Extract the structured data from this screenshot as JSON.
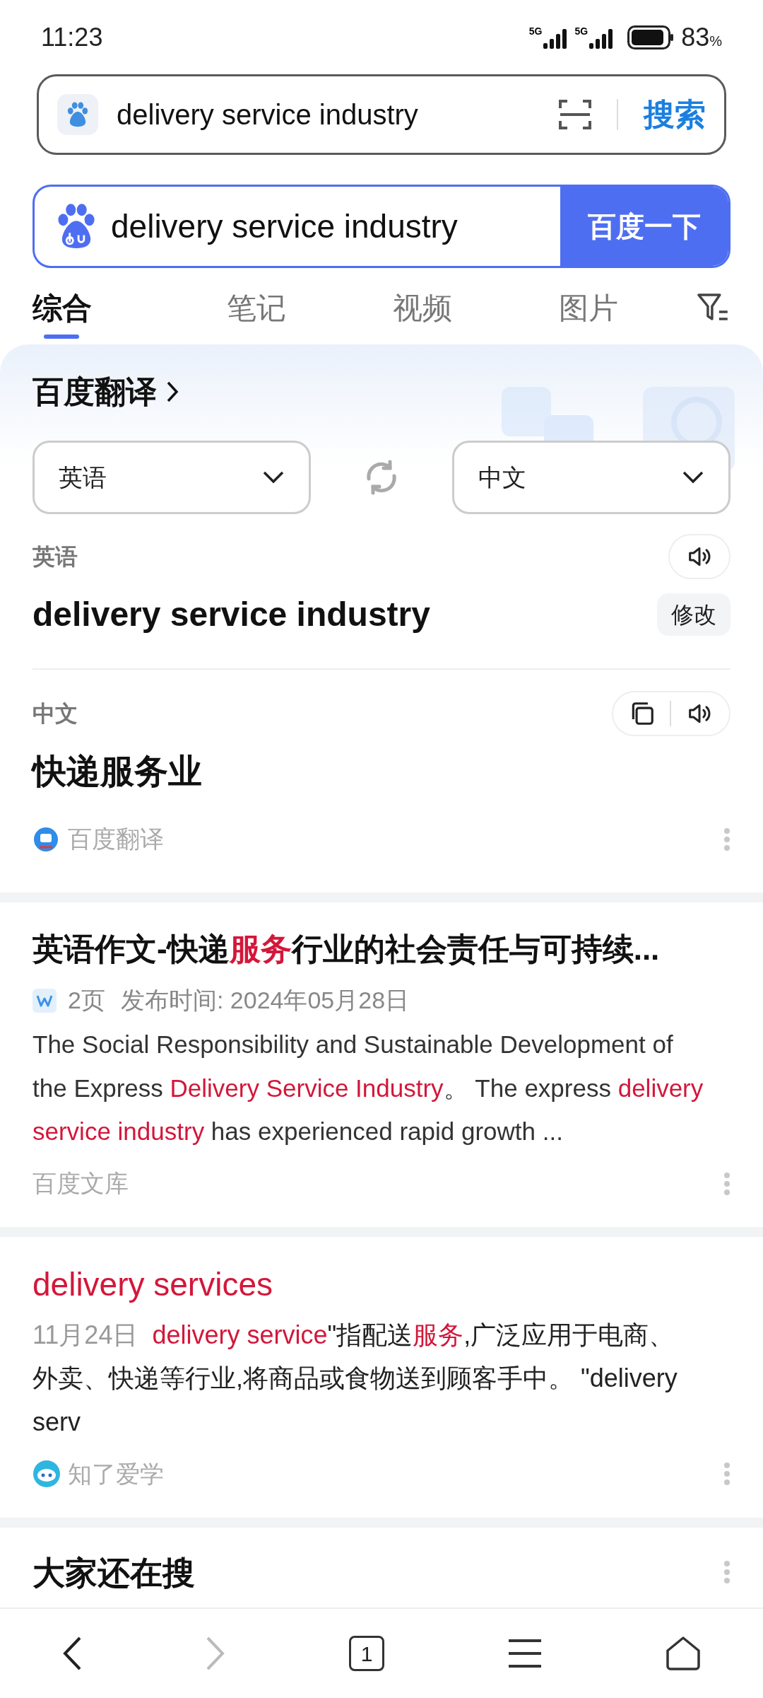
{
  "status_bar": {
    "time": "11:23",
    "network": [
      "5G",
      "5G"
    ],
    "battery": "83",
    "battery_unit": "%"
  },
  "browser_bar": {
    "query": "delivery service industry",
    "search_button": "搜索"
  },
  "search": {
    "query": "delivery service industry",
    "button": "百度一下"
  },
  "tabs": [
    {
      "label": "综合",
      "selected": true
    },
    {
      "label": "笔记",
      "selected": false
    },
    {
      "label": "视频",
      "selected": false
    },
    {
      "label": "图片",
      "selected": false
    }
  ],
  "translate_card": {
    "title": "百度翻译",
    "source_language": "英语",
    "target_language": "中文",
    "source_label": "英语",
    "source_text": "delivery service industry",
    "edit_button": "修改",
    "target_label": "中文",
    "target_text": "快递服务业",
    "provider": "百度翻译"
  },
  "results": [
    {
      "kind": "doc",
      "title": [
        {
          "text": "英语作文-快递",
          "highlight": false
        },
        {
          "text": "服务",
          "highlight": true
        },
        {
          "text": "行业的社会责任与可持续...",
          "highlight": false
        }
      ],
      "pages": "2页",
      "date": "发布时间: 2024年05月28日",
      "snippet": [
        {
          "text": "The Social Responsibility and Sustainable Development of the Express ",
          "highlight": false
        },
        {
          "text": "Delivery Service Industry",
          "highlight": true
        },
        {
          "text": "。 The express ",
          "highlight": false
        },
        {
          "text": "delivery service industry",
          "highlight": true
        },
        {
          "text": " has experienced rapid growth ...",
          "highlight": false
        }
      ],
      "source": "百度文库"
    },
    {
      "kind": "qa",
      "title": [
        {
          "text": "delivery services",
          "highlight": true
        }
      ],
      "date": "11月24日",
      "snippet": [
        {
          "text": "delivery service",
          "highlight": true
        },
        {
          "text": "\"指配送",
          "highlight": false
        },
        {
          "text": "服务",
          "highlight": true
        },
        {
          "text": ",广泛应用于电商、外卖、快递等行业,将商品或食物送到顾客手中。 \"delivery serv",
          "highlight": false
        }
      ],
      "source": "知了爱学"
    }
  ],
  "related": {
    "title": "大家还在搜"
  },
  "bottom_nav": {
    "back_disabled": false,
    "forward_disabled": true,
    "tab_count": "1"
  }
}
